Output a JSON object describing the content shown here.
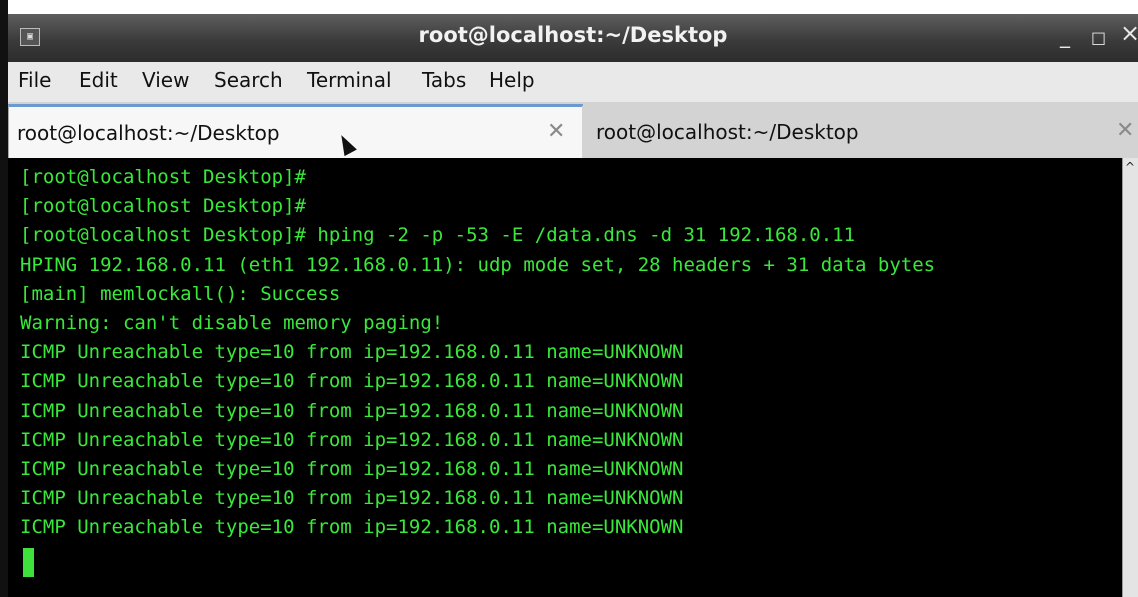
{
  "window": {
    "title": "root@localhost:~/Desktop",
    "title_icon": "terminal-icon",
    "controls": {
      "minimize": "_",
      "maximize": "□",
      "close": "×"
    }
  },
  "menu": {
    "items": [
      "File",
      "Edit",
      "View",
      "Search",
      "Terminal",
      "Tabs",
      "Help"
    ]
  },
  "tabs": [
    {
      "label": "root@localhost:~/Desktop",
      "close": "✕",
      "active": true
    },
    {
      "label": "root@localhost:~/Desktop",
      "close": "✕",
      "active": false
    }
  ],
  "terminal": {
    "text_color": "#39e83a",
    "background": "#000000",
    "lines": [
      "[root@localhost Desktop]#",
      "[root@localhost Desktop]#",
      "[root@localhost Desktop]# hping -2 -p -53 -E /data.dns -d 31 192.168.0.11",
      "HPING 192.168.0.11 (eth1 192.168.0.11): udp mode set, 28 headers + 31 data bytes",
      "[main] memlockall(): Success",
      "Warning: can't disable memory paging!",
      "ICMP Unreachable type=10 from ip=192.168.0.11 name=UNKNOWN",
      "ICMP Unreachable type=10 from ip=192.168.0.11 name=UNKNOWN",
      "ICMP Unreachable type=10 from ip=192.168.0.11 name=UNKNOWN",
      "ICMP Unreachable type=10 from ip=192.168.0.11 name=UNKNOWN",
      "ICMP Unreachable type=10 from ip=192.168.0.11 name=UNKNOWN",
      "ICMP Unreachable type=10 from ip=192.168.0.11 name=UNKNOWN",
      "ICMP Unreachable type=10 from ip=192.168.0.11 name=UNKNOWN"
    ]
  }
}
